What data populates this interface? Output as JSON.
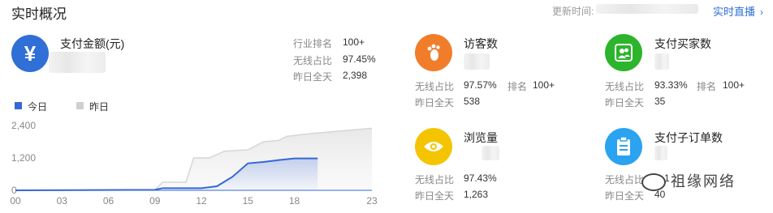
{
  "header": {
    "title": "实时概况",
    "update_label": "更新时间:",
    "live_link": "实时直播"
  },
  "payment": {
    "label": "支付金额(元)",
    "stats": [
      {
        "label": "行业排名",
        "value": "100+"
      },
      {
        "label": "无线占比",
        "value": "97.45%"
      },
      {
        "label": "昨日全天",
        "value": "2,398"
      }
    ]
  },
  "legend": {
    "today": "今日",
    "yesterday": "昨日"
  },
  "chart_data": {
    "type": "area",
    "x": [
      "00",
      "03",
      "06",
      "09",
      "12",
      "15",
      "18",
      "23"
    ],
    "y_ticks": [
      "2,400",
      "1,200",
      "0"
    ],
    "ylim": [
      0,
      2400
    ],
    "series": [
      {
        "name": "今日",
        "color": "#3567d8",
        "points": [
          [
            0,
            0
          ],
          [
            9,
            20
          ],
          [
            9.5,
            80
          ],
          [
            12,
            80
          ],
          [
            13,
            150
          ],
          [
            14,
            500
          ],
          [
            15,
            1000
          ],
          [
            16,
            1050
          ],
          [
            17,
            1120
          ],
          [
            18,
            1180
          ],
          [
            19.5,
            1180
          ]
        ]
      },
      {
        "name": "昨日",
        "color": "#cfcfcf",
        "points": [
          [
            0,
            0
          ],
          [
            9,
            20
          ],
          [
            9.5,
            300
          ],
          [
            11,
            300
          ],
          [
            11.5,
            1200
          ],
          [
            12.5,
            1200
          ],
          [
            13.5,
            1450
          ],
          [
            15,
            1500
          ],
          [
            16,
            1800
          ],
          [
            17,
            1850
          ],
          [
            17.5,
            2000
          ],
          [
            19,
            2100
          ],
          [
            20,
            2150
          ],
          [
            23,
            2300
          ]
        ]
      }
    ]
  },
  "metrics": {
    "visitors": {
      "label": "访客数",
      "stats": [
        {
          "label": "无线占比",
          "value": "97.57%"
        },
        {
          "label": "排名",
          "value": "100+"
        },
        {
          "label": "昨日全天",
          "value": "538"
        }
      ]
    },
    "buyers": {
      "label": "支付买家数",
      "stats": [
        {
          "label": "无线占比",
          "value": "93.33%"
        },
        {
          "label": "排名",
          "value": "100+"
        },
        {
          "label": "昨日全天",
          "value": "35"
        }
      ]
    },
    "pageviews": {
      "label": "浏览量",
      "stats": [
        {
          "label": "无线占比",
          "value": "97.43%"
        },
        {
          "label": "昨日全天",
          "value": "1,263"
        }
      ]
    },
    "suborders": {
      "label": "支付子订单数",
      "stats": [
        {
          "label": "无线占比",
          "value": "1"
        },
        {
          "label": "昨日全天",
          "value": "40"
        }
      ]
    }
  },
  "colors": {
    "payment": "#2f6fd6",
    "visitors": "#f17d2b",
    "buyers": "#2cb52c",
    "pageviews": "#f5c400",
    "suborders": "#2aa3f0"
  },
  "watermark": "祖缘网络"
}
